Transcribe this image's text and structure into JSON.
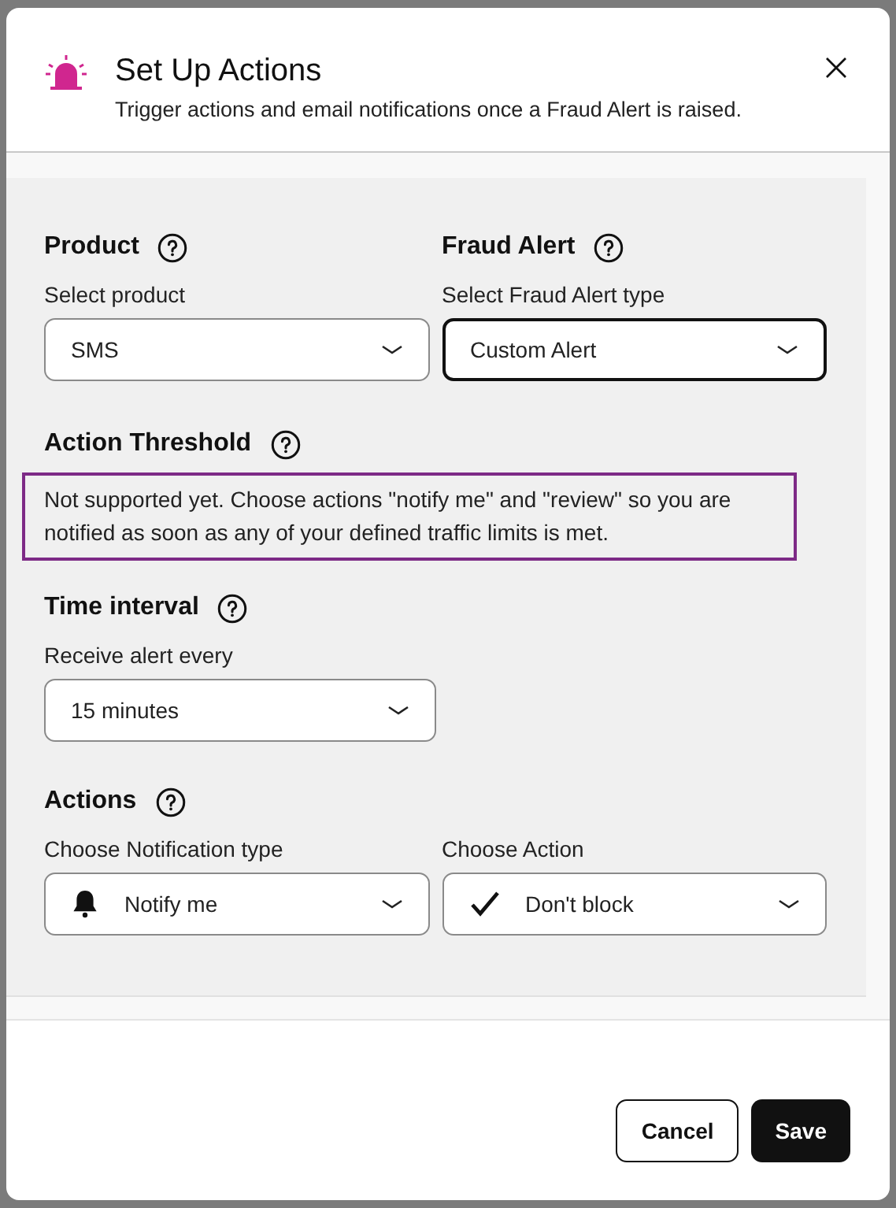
{
  "dialog": {
    "title": "Set Up Actions",
    "subtitle": "Trigger actions and email notifications once a Fraud Alert is raised."
  },
  "sections": [
    {
      "kind": "fields",
      "groups": [
        {
          "heading": "Product",
          "label": "Select product",
          "value": "SMS",
          "focused": false
        },
        {
          "heading": "Fraud Alert",
          "label": "Select Fraud Alert type",
          "value": "Custom Alert",
          "focused": true
        }
      ]
    },
    {
      "kind": "notice",
      "heading": "Action Threshold",
      "text": "Not supported yet. Choose actions \"notify me\" and \"review\" so you are notified as soon as any of your defined traffic limits is met."
    },
    {
      "kind": "fields",
      "groups": [
        {
          "heading": "Time interval",
          "label": "Receive alert every",
          "value": "15 minutes",
          "focused": false
        }
      ]
    },
    {
      "kind": "fields",
      "heading": "Actions",
      "groups": [
        {
          "label": "Choose Notification type",
          "value": "Notify me",
          "kind": "notification",
          "focused": false
        },
        {
          "label": "Choose Action",
          "value": "Don't block",
          "kind": "action",
          "focused": false
        }
      ]
    }
  ],
  "buttons": [
    {
      "label": "Cancel",
      "kind": "secondary"
    },
    {
      "label": "Save",
      "kind": "primary"
    }
  ]
}
